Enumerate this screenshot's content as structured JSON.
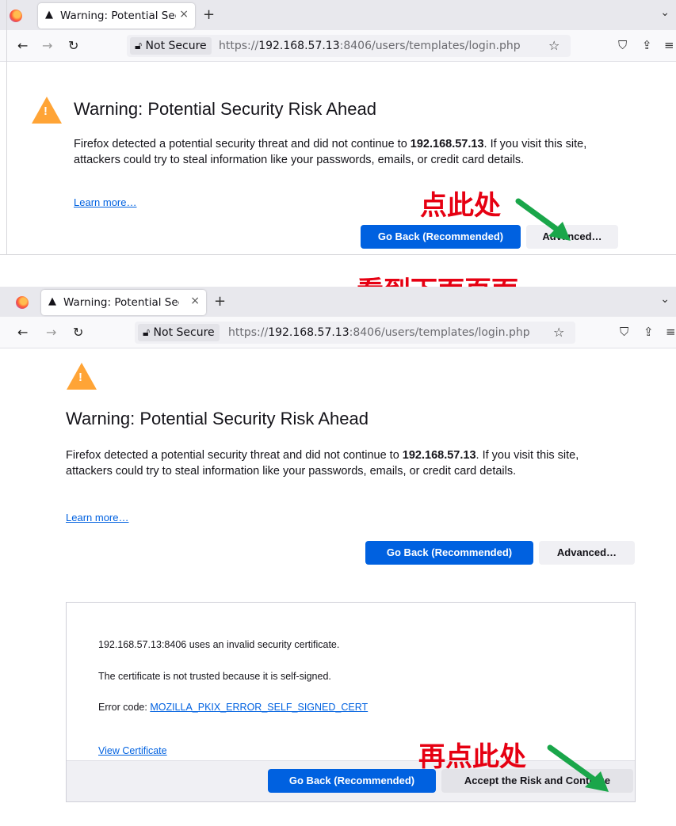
{
  "browser": {
    "tab_title": "Warning: Potential Sec",
    "tab_close": "×",
    "new_tab": "+",
    "not_secure": "Not Secure",
    "url_prefix": "https://",
    "url_host": "192.168.57.13",
    "url_rest": ":8406/users/templates/login.php",
    "icons": [
      "firefox-logo",
      "warning-icon",
      "back-arrow",
      "forward-arrow",
      "reload",
      "lock-slash",
      "star",
      "pocket",
      "extensions",
      "menu",
      "tab-list"
    ]
  },
  "page": {
    "warning_mark": "!",
    "title": "Warning: Potential Security Risk Ahead",
    "desc_before": "Firefox detected a potential security threat and did not continue to ",
    "desc_host": "192.168.57.13",
    "desc_after": ". If you visit this site, attackers could try to steal information like your passwords, emails, or credit card details.",
    "learn_more": "Learn more…",
    "go_back": "Go Back (Recommended)",
    "advanced": "Advanced…"
  },
  "advanced_panel": {
    "line1": "192.168.57.13:8406 uses an invalid security certificate.",
    "line2": "The certificate is not trusted because it is self-signed.",
    "error_label": "Error code: ",
    "error_code": "MOZILLA_PKIX_ERROR_SELF_SIGNED_CERT",
    "view_cert": "View Certificate",
    "go_back": "Go Back (Recommended)",
    "accept": "Accept the Risk and Continue"
  },
  "annotations": {
    "click_here": "点此处",
    "see_below": "看到下面页面",
    "click_again": "再点此处"
  },
  "colors": {
    "primary_button": "#0061e0",
    "warning": "#ffa436",
    "annotation": "#e60012",
    "arrow": "#1aa64a"
  }
}
